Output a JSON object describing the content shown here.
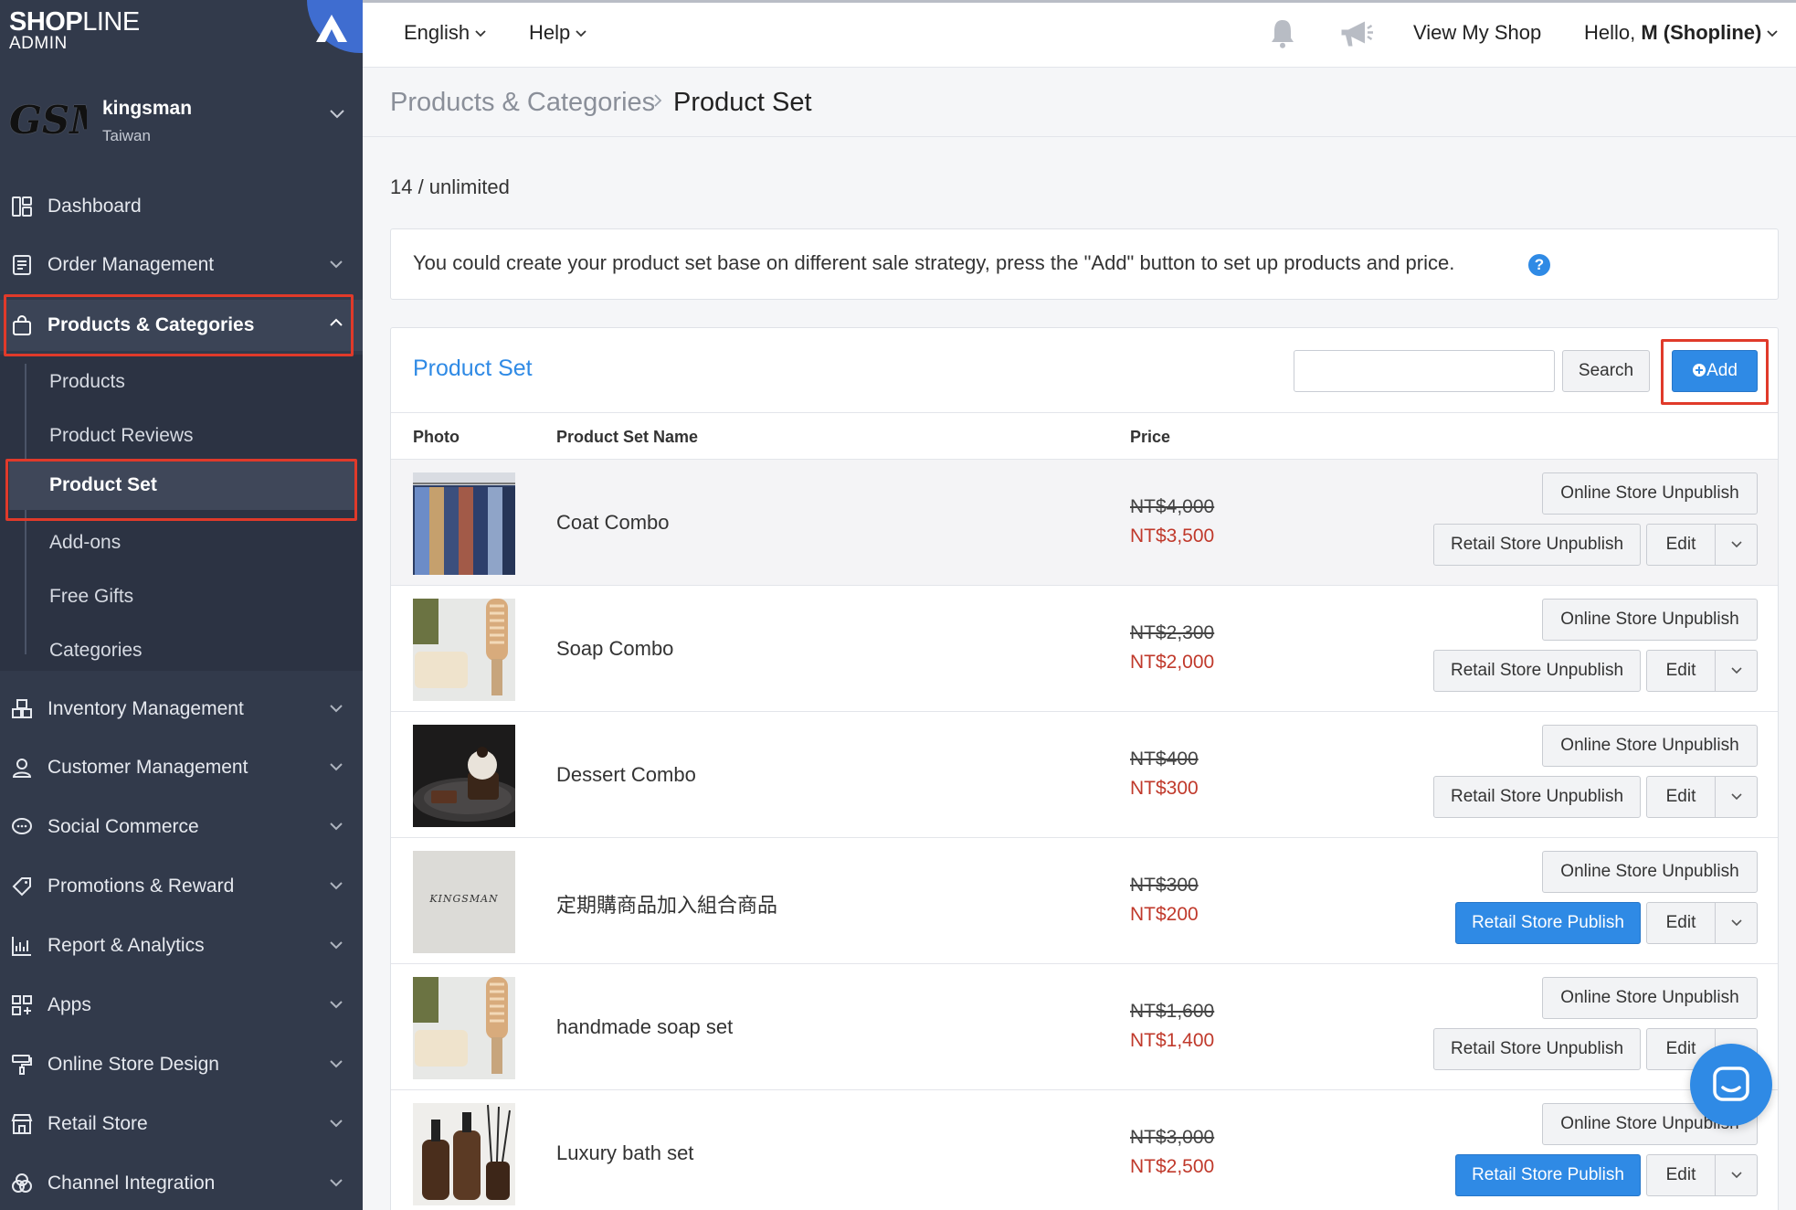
{
  "brand": {
    "name_bold": "SHOP",
    "name_light": "LINE",
    "sub": "ADMIN"
  },
  "store": {
    "logo_text": "GSM",
    "name": "kingsman",
    "region": "Taiwan"
  },
  "nav": {
    "dashboard": "Dashboard",
    "order_management": "Order Management",
    "products_categories": "Products & Categories",
    "inventory_management": "Inventory Management",
    "customer_management": "Customer Management",
    "social_commerce": "Social Commerce",
    "promotions_reward": "Promotions & Reward",
    "report_analytics": "Report & Analytics",
    "apps": "Apps",
    "online_store_design": "Online Store Design",
    "retail_store": "Retail Store",
    "channel_integration": "Channel Integration"
  },
  "subnav": {
    "products": "Products",
    "product_reviews": "Product Reviews",
    "product_set": "Product Set",
    "addons": "Add-ons",
    "free_gifts": "Free Gifts",
    "categories": "Categories"
  },
  "topbar": {
    "language": "English",
    "help": "Help",
    "view_shop": "View My Shop",
    "hello_prefix": "Hello, ",
    "hello_user": "M (Shopline)"
  },
  "breadcrumb": {
    "parent": "Products & Categories",
    "current": "Product Set"
  },
  "quota": "14 / unlimited",
  "info_text": "You could create your product set base on different sale strategy, press the \"Add\" button to set up products and price.",
  "panel": {
    "title": "Product Set",
    "search_placeholder": "",
    "search_label": "Search",
    "add_label": "Add"
  },
  "table": {
    "headers": {
      "photo": "Photo",
      "name": "Product Set Name",
      "price": "Price"
    },
    "rows": [
      {
        "name": "Coat Combo",
        "old_price": "NT$4,000",
        "new_price": "NT$3,500",
        "online": "Online Store Unpublish",
        "retail": "Retail Store Unpublish",
        "retail_primary": false,
        "edit": "Edit"
      },
      {
        "name": "Soap Combo",
        "old_price": "NT$2,300",
        "new_price": "NT$2,000",
        "online": "Online Store Unpublish",
        "retail": "Retail Store Unpublish",
        "retail_primary": false,
        "edit": "Edit"
      },
      {
        "name": "Dessert Combo",
        "old_price": "NT$400",
        "new_price": "NT$300",
        "online": "Online Store Unpublish",
        "retail": "Retail Store Unpublish",
        "retail_primary": false,
        "edit": "Edit"
      },
      {
        "name": "定期購商品加入組合商品",
        "old_price": "NT$300",
        "new_price": "NT$200",
        "online": "Online Store Unpublish",
        "retail": "Retail Store Publish",
        "retail_primary": true,
        "edit": "Edit",
        "thumb_text": "KINGSMAN"
      },
      {
        "name": "handmade soap set",
        "old_price": "NT$1,600",
        "new_price": "NT$1,400",
        "online": "Online Store Unpublish",
        "retail": "Retail Store Unpublish",
        "retail_primary": false,
        "edit": "Edit"
      },
      {
        "name": "Luxury bath set",
        "old_price": "NT$3,000",
        "new_price": "NT$2,500",
        "online": "Online Store Unpublish",
        "retail": "Retail Store Publish",
        "retail_primary": true,
        "edit": "Edit"
      }
    ]
  },
  "colors": {
    "sidebar": "#323a4b",
    "accent": "#2f8ae5",
    "highlight": "#e03a2a",
    "price_red": "#c0392b"
  }
}
